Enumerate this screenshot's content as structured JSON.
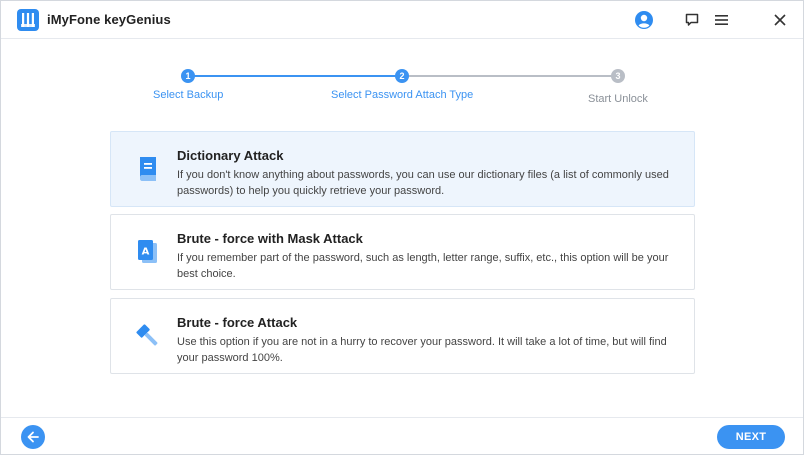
{
  "app": {
    "title": "iMyFone keyGenius",
    "logo_icon": "keygenius-logo-icon"
  },
  "titlebar": {
    "account_icon": "user-account-icon",
    "feedback_icon": "chat-feedback-icon",
    "menu_icon": "hamburger-menu-icon",
    "close_icon": "close-icon"
  },
  "stepper": {
    "steps": [
      {
        "number": "1",
        "label": "Select Backup",
        "state": "completed"
      },
      {
        "number": "2",
        "label": "Select Password Attach Type",
        "state": "active"
      },
      {
        "number": "3",
        "label": "Start Unlock",
        "state": "pending"
      }
    ]
  },
  "options": [
    {
      "icon": "dictionary-book-icon",
      "title": "Dictionary Attack",
      "description": "If you don't know anything about passwords, you can use our dictionary files (a list of commonly used passwords) to help you quickly retrieve your password.",
      "selected": true
    },
    {
      "icon": "mask-letter-a-icon",
      "title": "Brute - force with Mask Attack",
      "description": "If you remember part of the password, such as length, letter range, suffix, etc., this option will be your best choice.",
      "selected": false
    },
    {
      "icon": "hammer-gavel-icon",
      "title": "Brute - force Attack",
      "description": "Use this option if you are not in a hurry to recover your password. It will take a lot of time, but will find your password 100%.",
      "selected": false
    }
  ],
  "footer": {
    "back_icon": "arrow-left-icon",
    "next_label": "NEXT"
  },
  "colors": {
    "accent": "#3b93f2",
    "pending": "#b9bec6",
    "selected_bg": "#eef5fd"
  }
}
